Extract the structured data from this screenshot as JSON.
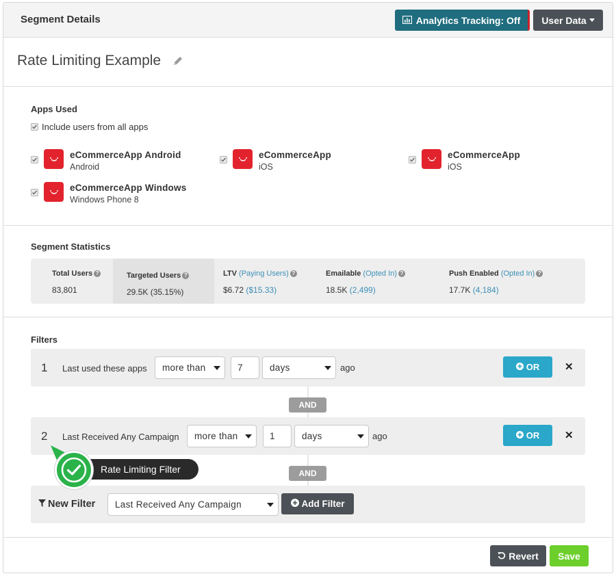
{
  "header": {
    "title": "Segment Details",
    "analytics_button": "Analytics Tracking: Off",
    "user_data_button": "User Data"
  },
  "segment": {
    "name": "Rate Limiting Example"
  },
  "apps_used": {
    "title": "Apps Used",
    "include_all_label": "Include users from all apps",
    "apps": [
      {
        "name": "eCommerceApp Android",
        "platform": "Android"
      },
      {
        "name": "eCommerceApp",
        "platform": "iOS"
      },
      {
        "name": "eCommerceApp",
        "platform": "iOS"
      },
      {
        "name": "eCommerceApp Windows",
        "platform": "Windows Phone 8"
      }
    ]
  },
  "stats": {
    "title": "Segment Statistics",
    "total_users": {
      "label": "Total Users",
      "value": "83,801"
    },
    "targeted_users": {
      "label": "Targeted Users",
      "value": "29.5K (35.15%)"
    },
    "ltv": {
      "label": "LTV",
      "label_link": "(Paying Users)",
      "value": "$6.72",
      "value_link": "($15.33)"
    },
    "emailable": {
      "label": "Emailable",
      "label_link": "(Opted In)",
      "value": "18.5K",
      "value_link": "(2,499)"
    },
    "push": {
      "label": "Push Enabled",
      "label_link": "(Opted In)",
      "value": "17.7K",
      "value_link": "(4,184)"
    }
  },
  "filters": {
    "title": "Filters",
    "rows": [
      {
        "number": "1",
        "label": "Last used these apps",
        "comparator": "more than",
        "amount": "7",
        "unit": "days",
        "suffix": "ago",
        "or_label": "OR"
      },
      {
        "number": "2",
        "label": "Last Received Any Campaign",
        "comparator": "more than",
        "amount": "1",
        "unit": "days",
        "suffix": "ago",
        "or_label": "OR"
      }
    ],
    "and_label": "AND",
    "new_filter": {
      "label": "New Filter",
      "selected": "Last Received Any Campaign",
      "add_button": "Add Filter"
    }
  },
  "callout": {
    "label": "Rate Limiting Filter"
  },
  "footer": {
    "revert_label": "Revert",
    "save_label": "Save"
  },
  "colors": {
    "analytics_teal": "#1f6d7e",
    "dark_button": "#4b5156",
    "or_blue": "#2aa7c9",
    "save_green": "#6ccf2b",
    "app_red": "#e2232d",
    "callout_green": "#2bb34a",
    "link_blue": "#3d8fb6"
  }
}
